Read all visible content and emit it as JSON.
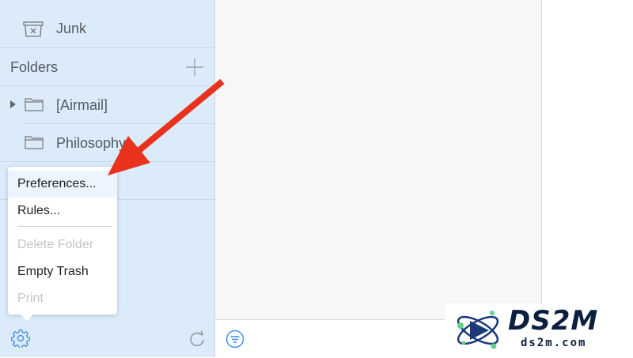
{
  "sidebar": {
    "junk_label": "Junk",
    "folders_header": "Folders",
    "folders": [
      {
        "label": "[Airmail]"
      },
      {
        "label": "Philosophy"
      }
    ]
  },
  "menu": {
    "items": [
      {
        "label": "Preferences...",
        "enabled": true,
        "highlighted": true
      },
      {
        "label": "Rules...",
        "enabled": true
      },
      {
        "label": "Delete Folder",
        "enabled": false
      },
      {
        "label": "Empty Trash",
        "enabled": true
      },
      {
        "label": "Print",
        "enabled": false
      }
    ]
  },
  "watermark": {
    "title": "DS2M",
    "subtitle": "ds2m.com"
  },
  "colors": {
    "sidebar_bg": "#dbebfa",
    "accent_blue": "#3d8ee6",
    "arrow_red": "#e8321c"
  }
}
